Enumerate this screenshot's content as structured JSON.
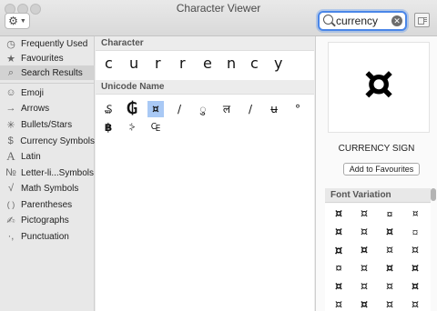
{
  "window": {
    "title": "Character Viewer"
  },
  "toolbar": {
    "gear_icon": "gear-icon",
    "search_value": "currency"
  },
  "sidebar": {
    "items": [
      {
        "icon": "◷",
        "label": "Frequently Used"
      },
      {
        "icon": "★",
        "label": "Favourites"
      },
      {
        "icon": "⌕",
        "label": "Search Results"
      },
      {
        "icon": "☺",
        "label": "Emoji"
      },
      {
        "icon": "→",
        "label": "Arrows"
      },
      {
        "icon": "✳",
        "label": "Bullets/Stars"
      },
      {
        "icon": "$",
        "label": "Currency Symbols"
      },
      {
        "icon": "A",
        "label": "Latin"
      },
      {
        "icon": "№",
        "label": "Letter-li...Symbols"
      },
      {
        "icon": "√",
        "label": "Math Symbols"
      },
      {
        "icon": "( )",
        "label": "Parentheses"
      },
      {
        "icon": "✍",
        "label": "Pictographs"
      },
      {
        "icon": "·,",
        "label": "Punctuation"
      }
    ]
  },
  "main": {
    "character_heading": "Character",
    "character_results": [
      "c",
      "u",
      "r",
      "r",
      "e",
      "n",
      "c",
      "y"
    ],
    "unicode_heading": "Unicode Name",
    "unicode_results": [
      "₷",
      "₲",
      "¤",
      "/",
      "ु",
      "ल",
      "/",
      "ʉ",
      "°",
      "฿",
      "⸖",
      "₠"
    ]
  },
  "detail": {
    "preview_glyph": "¤",
    "name": "CURRENCY SIGN",
    "add_button": "Add to Favourites",
    "font_variation_heading": "Font Variation",
    "font_variations": [
      "¤",
      "¤",
      "¤",
      "¤",
      "¤",
      "¤",
      "¤",
      "¤",
      "¤",
      "¤",
      "¤",
      "¤",
      "¤",
      "¤",
      "¤",
      "¤",
      "¤",
      "¤",
      "¤",
      "¤",
      "¤",
      "¤",
      "¤",
      "¤"
    ]
  }
}
